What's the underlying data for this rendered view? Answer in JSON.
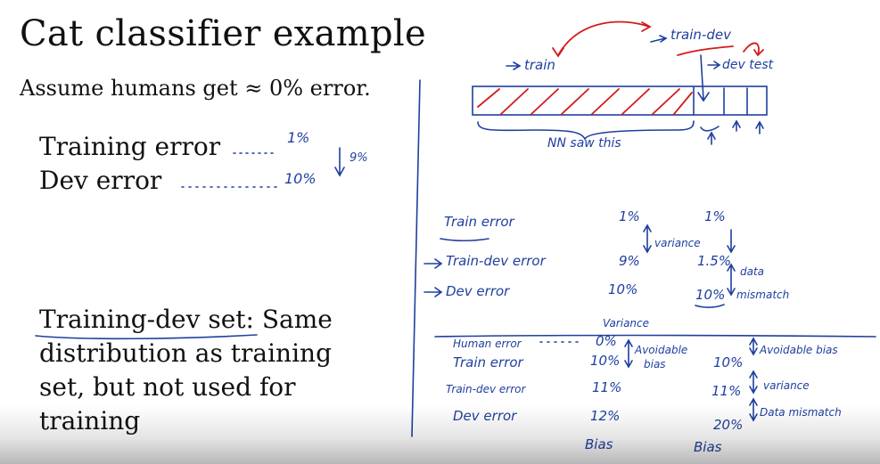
{
  "slide": {
    "title": "Cat classifier example",
    "assumption": "Assume humans get ≈ 0% error.",
    "training_error_label": "Training error",
    "dev_error_label": "Dev error",
    "training_dev_term": "Training-dev set",
    "training_dev_line1_rest": ": Same",
    "training_dev_line2": "distribution as training",
    "training_dev_line3": "set, but not used for",
    "training_dev_line4": "training"
  },
  "left_notes": {
    "train_value": "1%",
    "dev_value": "10%",
    "gap": "9%"
  },
  "diagram": {
    "train_label": "train",
    "train_dev_label": "train-dev",
    "dev_test_label": "dev test",
    "nn_label": "NN saw this"
  },
  "table1": {
    "rows": [
      {
        "label": "Train error",
        "col1": "1%",
        "col2": "1%"
      },
      {
        "label": "Train-dev error",
        "col1": "9%",
        "col2": "1.5%"
      },
      {
        "label": "Dev error",
        "col1": "10%",
        "col2": "10%"
      }
    ],
    "col1_annot": "variance",
    "col2_annot_line1": "data",
    "col2_annot_line2": "mismatch",
    "caption": "Variance"
  },
  "table2": {
    "rows": [
      {
        "label": "Human error",
        "col1": "0%",
        "col2": ""
      },
      {
        "label": "Train error",
        "col1": "10%",
        "col2": "10%"
      },
      {
        "label": "Train-dev error",
        "col1": "11%",
        "col2": "11%"
      },
      {
        "label": "Dev error",
        "col1": "12%",
        "col2": "20%"
      }
    ],
    "col1_annot_line1": "Avoidable",
    "col1_annot_line2": "bias",
    "col2_annot_avoidable": "Avoidable bias",
    "col2_annot_variance": "variance",
    "col2_annot_mismatch": "Data mismatch",
    "col1_footer": "Bias",
    "col2_footer": "Bias"
  }
}
